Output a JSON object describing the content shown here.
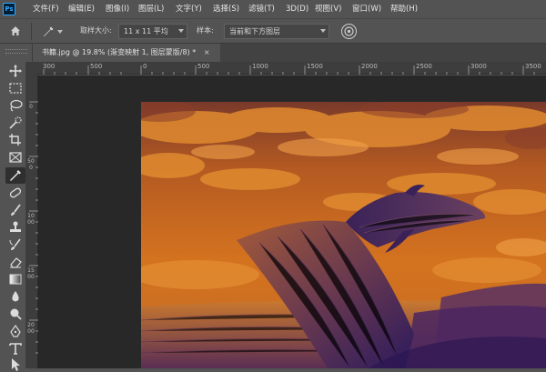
{
  "app": {
    "logo": "Ps"
  },
  "menu": [
    "文件(F)",
    "编辑(E)",
    "图像(I)",
    "图层(L)",
    "文字(Y)",
    "选择(S)",
    "滤镜(T)",
    "3D(D)",
    "视图(V)",
    "窗口(W)",
    "帮助(H)"
  ],
  "options": {
    "sample_size_label": "取样大小:",
    "sample_size_value": "11 x 11 平均",
    "sample_label": "样本:",
    "sample_value": "当前和下方图层"
  },
  "document_tab": {
    "title": "书籍.jpg @ 19.8% (渐变映射 1, 图层蒙版/8) *",
    "close": "×"
  },
  "ruler": {
    "horizontal": [
      "300",
      "500",
      "0",
      "500",
      "1000",
      "1500",
      "2000",
      "2500",
      "3000",
      "3500"
    ],
    "vertical": [
      "0",
      "500",
      "1000",
      "1500",
      "2000"
    ]
  },
  "tools": [
    "move-tool",
    "marquee-tool",
    "lasso-tool",
    "quick-select-tool",
    "crop-tool",
    "frame-tool",
    "eyedropper-tool",
    "healing-brush-tool",
    "brush-tool",
    "clone-stamp-tool",
    "history-brush-tool",
    "eraser-tool",
    "gradient-tool",
    "blur-tool",
    "dodge-tool",
    "pen-tool",
    "type-tool",
    "path-select-tool"
  ],
  "colors": {
    "ui": "#535353",
    "sky_orange": "#c8651e",
    "shadow_purple": "#3a1d6a"
  }
}
